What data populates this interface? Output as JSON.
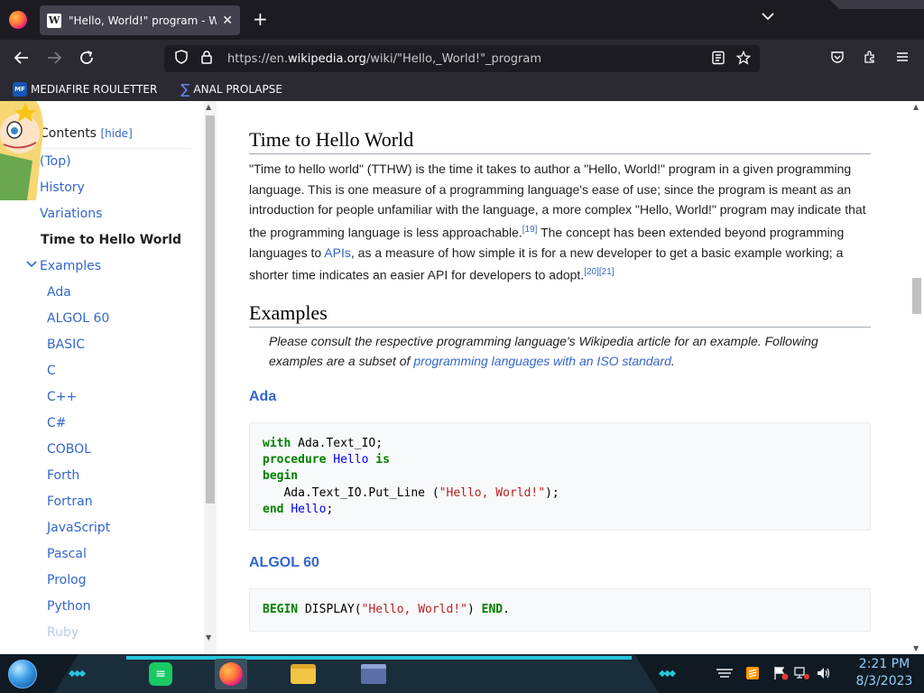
{
  "browser": {
    "tab_title": "\"Hello, World!\" program - Wikip",
    "tab_close": "✕",
    "new_tab": "+",
    "url_host_prefix": "https://en.",
    "url_host": "wikipedia.org",
    "url_path": "/wiki/\"Hello,_World!\"_program",
    "bookmarks": [
      {
        "icon": "MF",
        "label": "MEDIAFIRE ROULETTER"
      },
      {
        "icon": "∑",
        "label": "ANAL PROLAPSE"
      }
    ]
  },
  "toc": {
    "heading": "Contents",
    "hide_label": "hide",
    "items": [
      {
        "label": "(Top)"
      },
      {
        "label": "History"
      },
      {
        "label": "Variations"
      },
      {
        "label": "Time to Hello World"
      },
      {
        "label": "Examples"
      },
      {
        "label": "Ada"
      },
      {
        "label": "ALGOL 60"
      },
      {
        "label": "BASIC"
      },
      {
        "label": "C"
      },
      {
        "label": "C++"
      },
      {
        "label": "C#"
      },
      {
        "label": "COBOL"
      },
      {
        "label": "Forth"
      },
      {
        "label": "Fortran"
      },
      {
        "label": "JavaScript"
      },
      {
        "label": "Pascal"
      },
      {
        "label": "Prolog"
      },
      {
        "label": "Python"
      },
      {
        "label": "Ruby"
      }
    ]
  },
  "article": {
    "section1_title": "Time to Hello World",
    "section1_p1": "\"Time to hello world\" (TTHW) is the time it takes to author a \"Hello, World!\" program in a given programming language. This is one measure of a programming language's ease of use; since the program is meant as an introduction for people unfamiliar with the language, a more complex \"Hello, World!\" program may indicate that the programming language is less approachable.",
    "ref19": "[19]",
    "section1_p2": " The concept has been extended beyond programming languages to ",
    "apis_link": "APIs",
    "section1_p3": ", as a measure of how simple it is for a new developer to get a basic example working; a shorter time indicates an easier API for developers to adopt.",
    "ref20": "[20]",
    "ref21": "[21]",
    "section2_title": "Examples",
    "hatnote_1": "Please consult the respective programming language's Wikipedia article for an example. Following examples are a subset of ",
    "hatnote_link": "programming languages with an ISO standard",
    "hatnote_end": ".",
    "ada_title": "Ada",
    "algol_title": "ALGOL 60"
  },
  "taskbar": {
    "time": "2:21 PM",
    "date": "8/3/2023"
  },
  "colors": {
    "link": "#3366cc",
    "keyword": "#008000",
    "string": "#ba2121",
    "name": "#0000ff"
  }
}
